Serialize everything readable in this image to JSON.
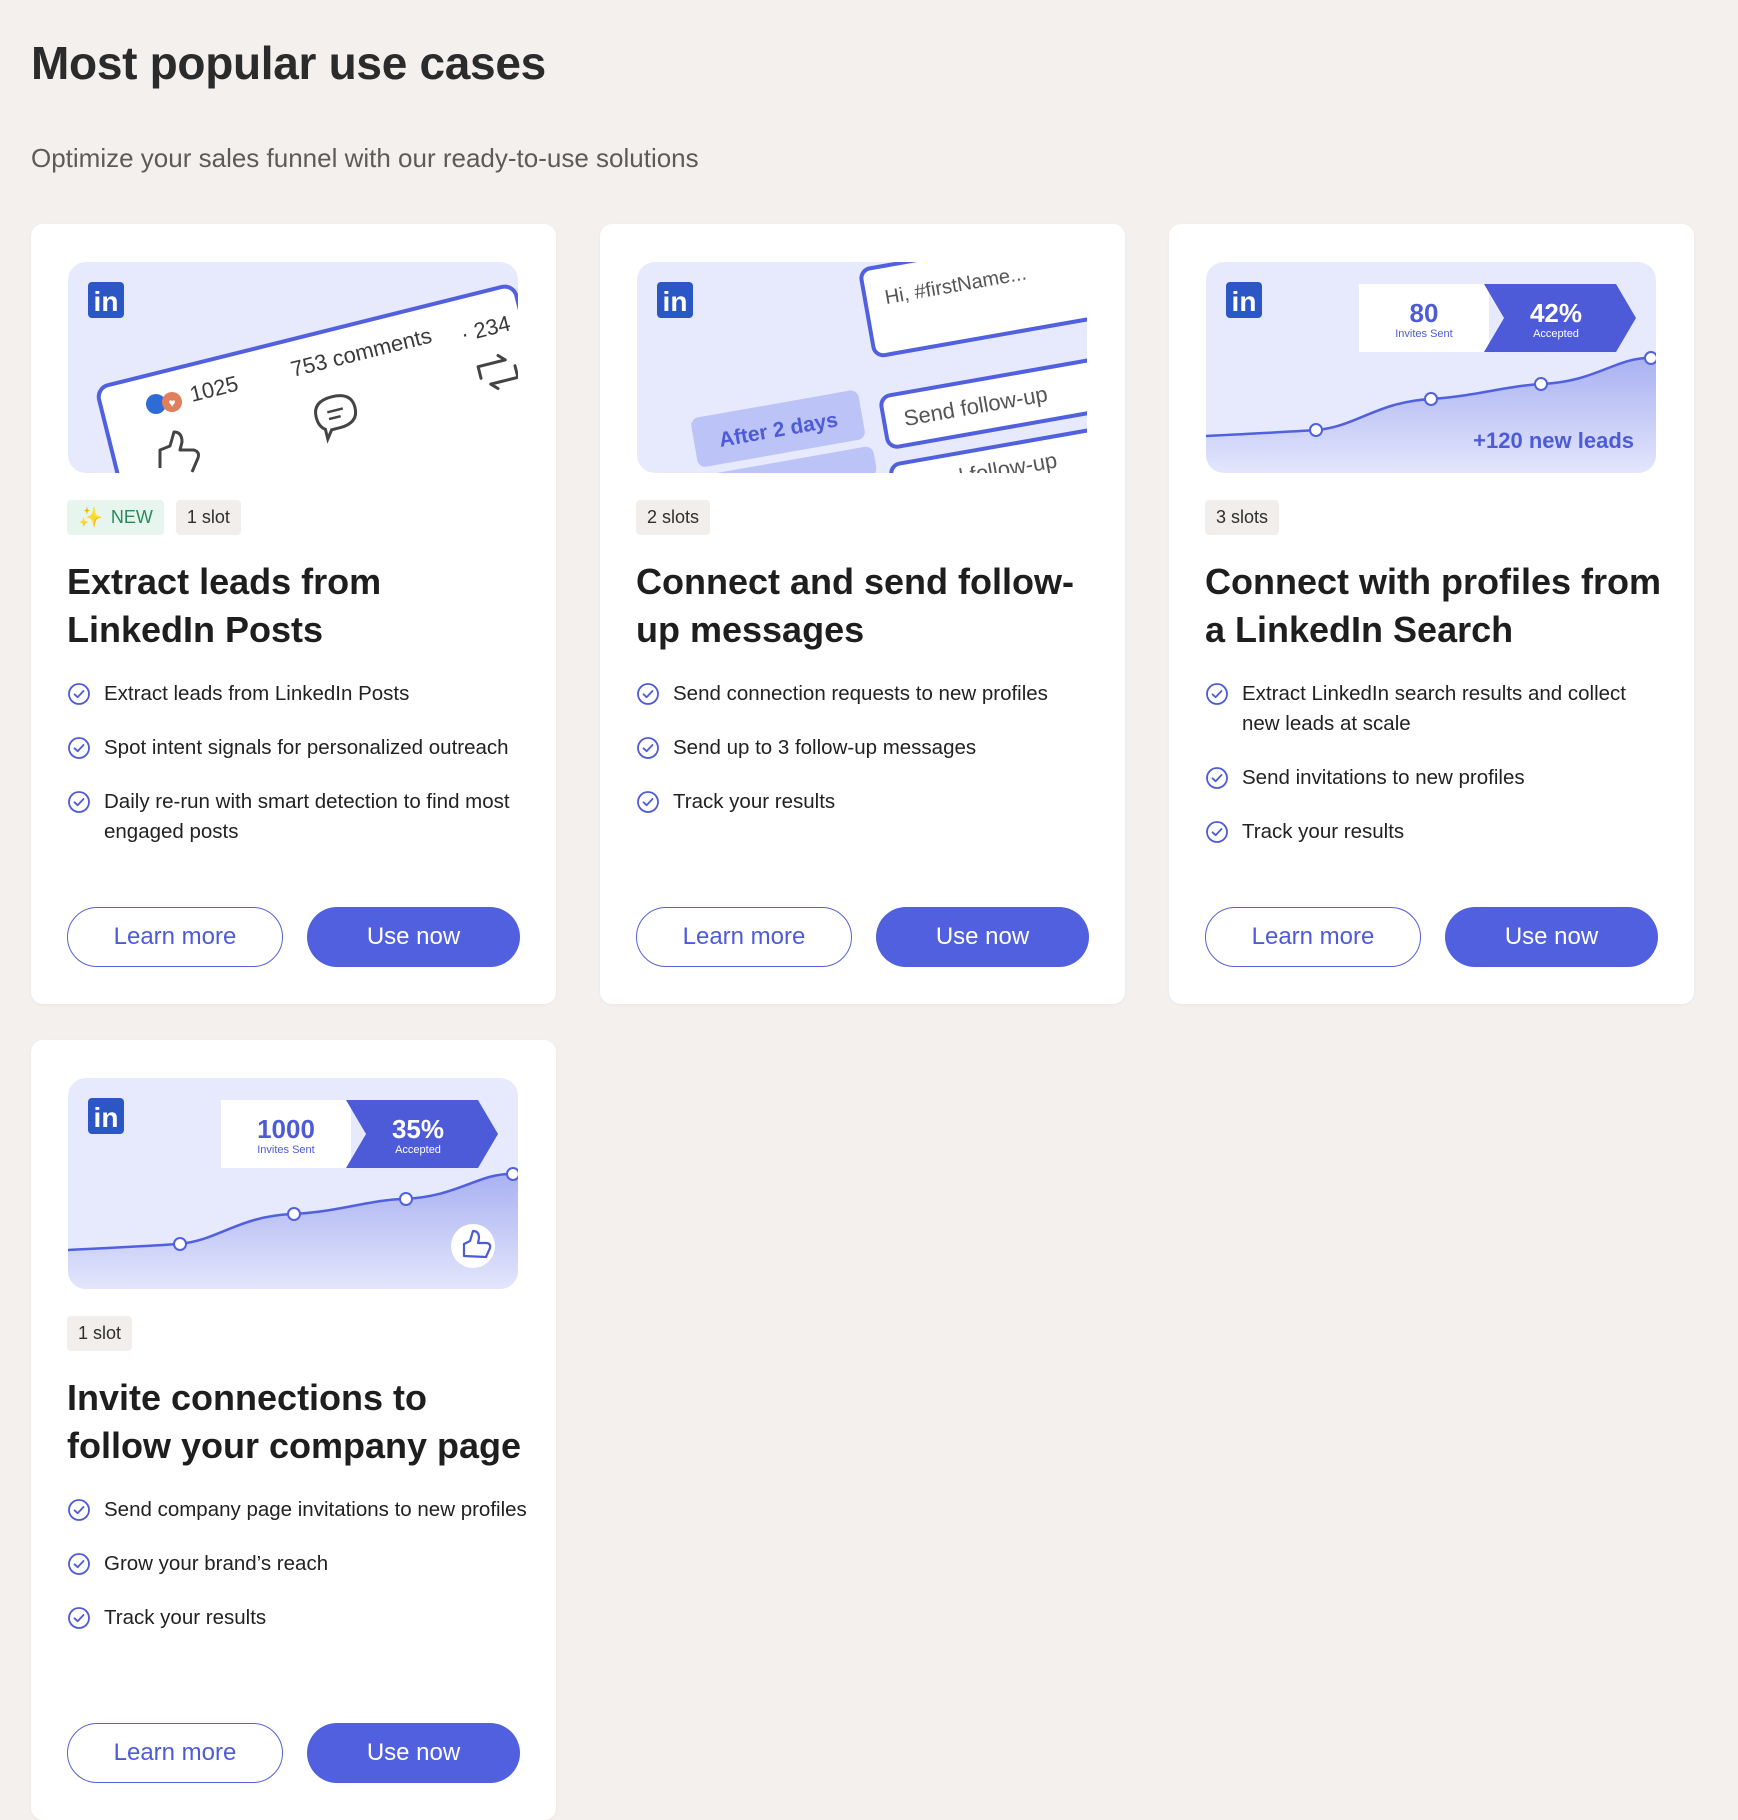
{
  "page": {
    "title": "Most popular use cases",
    "subtitle": "Optimize your sales funnel with our ready-to-use solutions"
  },
  "colors": {
    "background": "#f3f0ed",
    "accent": "#5160de",
    "visual_bg": "#e7eafd",
    "linkedin": "#2a57c5",
    "new_badge": "#2b8a5e"
  },
  "cards": [
    {
      "visual": {
        "likes": "1025",
        "comments": "753 comments",
        "shares": "· 234"
      },
      "badges": [
        "NEW",
        "1 slot"
      ],
      "title": "Extract leads from LinkedIn Posts",
      "features": [
        "Extract leads from LinkedIn Posts",
        "Spot intent signals for personalized outreach",
        "Daily re-run with smart detection to find most engaged posts"
      ],
      "learn_more": "Learn more",
      "use_now": "Use now"
    },
    {
      "visual": {
        "message": "Hi, #firstName...",
        "delay": "After 2 days",
        "followup": "Send follow-up",
        "followup2": "Send follow-up"
      },
      "badges": [
        "2 slots"
      ],
      "title": "Connect and send follow-up messages",
      "features": [
        "Send connection requests to new profiles",
        "Send up to 3 follow-up messages",
        "Track your results"
      ],
      "learn_more": "Learn more",
      "use_now": "Use now"
    },
    {
      "visual": {
        "invites": "80",
        "invites_label": "Invites Sent",
        "accepted": "42%",
        "accepted_label": "Accepted",
        "leads": "+120 new leads"
      },
      "badges": [
        "3 slots"
      ],
      "title": "Connect with profiles from a LinkedIn Search",
      "features": [
        "Extract LinkedIn search results and collect new leads at scale",
        "Send invitations to new profiles",
        "Track your results"
      ],
      "learn_more": "Learn more",
      "use_now": "Use now"
    },
    {
      "visual": {
        "invites": "1000",
        "invites_label": "Invites Sent",
        "accepted": "35%",
        "accepted_label": "Accepted"
      },
      "badges": [
        "1 slot"
      ],
      "title": "Invite connections to follow your company page",
      "features": [
        "Send company page invitations to new profiles",
        "Grow your brand’s reach",
        "Track your results"
      ],
      "learn_more": "Learn more",
      "use_now": "Use now"
    }
  ]
}
